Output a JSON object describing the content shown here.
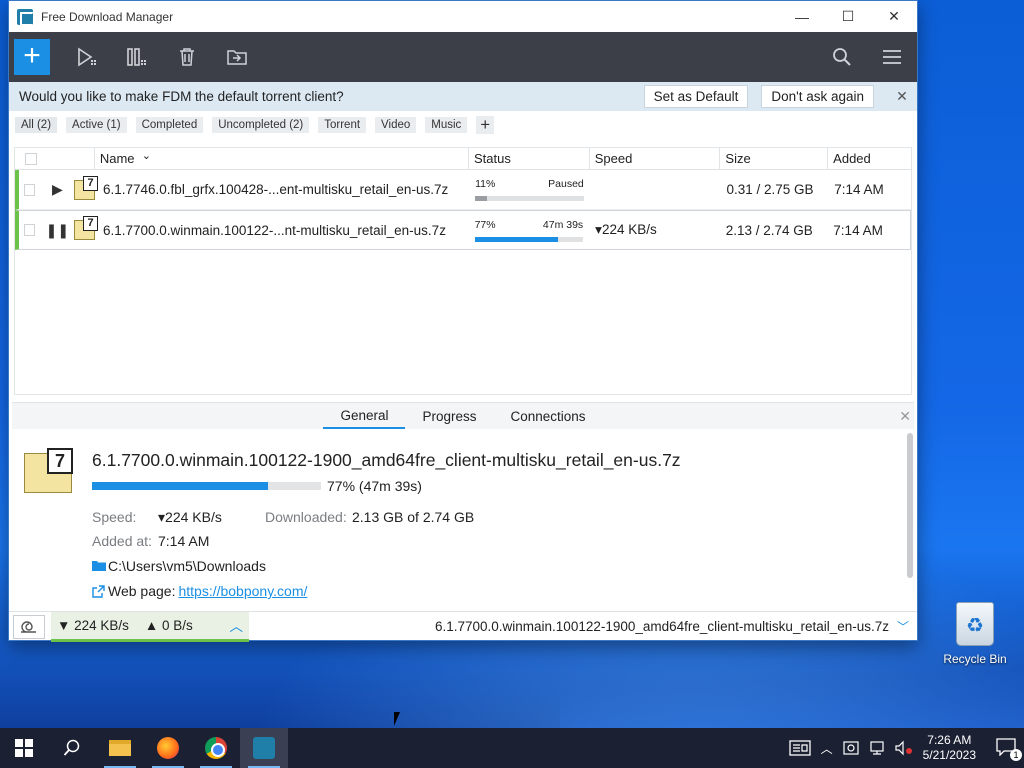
{
  "window": {
    "title": "Free Download Manager",
    "minimize_glyph": "—",
    "maximize_glyph": "☐",
    "close_glyph": "✕"
  },
  "toolbar": {
    "add_glyph": "+",
    "icons": [
      "play-all-icon",
      "pause-all-icon",
      "delete-icon",
      "move-icon",
      "search-icon",
      "menu-icon"
    ]
  },
  "banner": {
    "message": "Would you like to make FDM the default torrent client?",
    "set_default": "Set as Default",
    "dont_ask": "Don't ask again",
    "close_glyph": "✕"
  },
  "filters": [
    {
      "label": "All (2)",
      "active": true
    },
    {
      "label": "Active (1)",
      "active": false
    },
    {
      "label": "Completed",
      "active": false
    },
    {
      "label": "Uncompleted (2)",
      "active": false
    },
    {
      "label": "Torrent",
      "active": false
    },
    {
      "label": "Video",
      "active": false
    },
    {
      "label": "Music",
      "active": false
    }
  ],
  "table": {
    "columns": {
      "name": "Name",
      "status": "Status",
      "speed": "Speed",
      "size": "Size",
      "added": "Added"
    },
    "sort_glyph": "⌄",
    "rows": [
      {
        "control": "▶",
        "name": "6.1.7746.0.fbl_grfx.100428-...ent-multisku_retail_en-us.7z",
        "percent": "11%",
        "state": "Paused",
        "progress": 0.11,
        "speed": "",
        "size": "0.31 / 2.75 GB",
        "added": "7:14 AM"
      },
      {
        "control": "❚❚",
        "name": "6.1.7700.0.winmain.100122-...nt-multisku_retail_en-us.7z",
        "percent": "77%",
        "state": "47m 39s",
        "progress": 0.77,
        "speed": "▾224 KB/s",
        "size": "2.13 / 2.74 GB",
        "added": "7:14 AM"
      }
    ]
  },
  "details": {
    "tabs": [
      "General",
      "Progress",
      "Connections"
    ],
    "active_tab": "General",
    "file_name": "6.1.7700.0.winmain.100122-1900_amd64fre_client-multisku_retail_en-us.7z",
    "progress": 0.77,
    "progress_text": "77% (47m 39s)",
    "speed_label": "Speed:",
    "speed_value": "▾224 KB/s",
    "downloaded_label": "Downloaded:",
    "downloaded_value": "2.13 GB of 2.74 GB",
    "added_label": "Added at:",
    "added_value": "7:14 AM",
    "path": "C:\\Users\\vm5\\Downloads",
    "webpage_label": "Web page:",
    "webpage_url": "https://bobpony.com/",
    "close_glyph": "✕"
  },
  "statusbar": {
    "down_speed": "▼ 224 KB/s",
    "up_speed": "▲ 0 B/s",
    "current_file": "6.1.7700.0.winmain.100122-1900_amd64fre_client-multisku_retail_en-us.7z"
  },
  "desktop": {
    "recycle_bin": "Recycle Bin"
  },
  "taskbar": {
    "time": "7:26 AM",
    "date": "5/21/2023",
    "notification_count": "1"
  }
}
